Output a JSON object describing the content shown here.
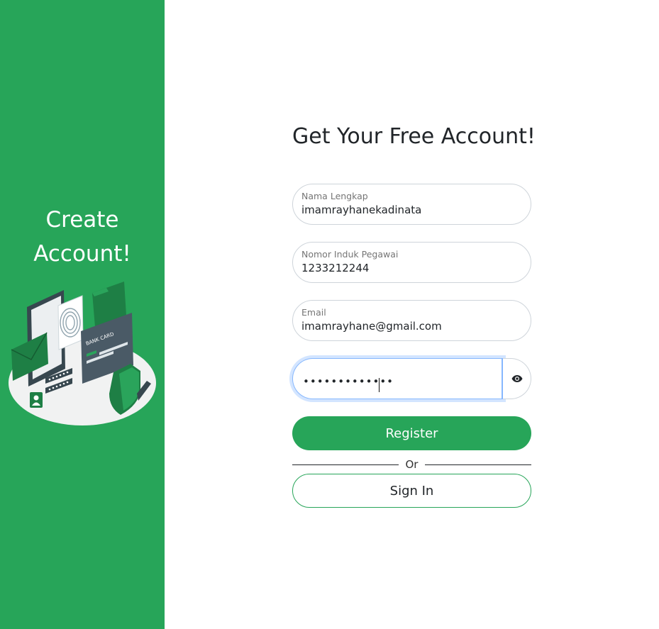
{
  "sidebar": {
    "title_line1": "Create",
    "title_line2": "Account!",
    "illustration_card_text": "BANK CARD"
  },
  "form": {
    "heading": "Get Your Free Account!",
    "full_name": {
      "label": "Nama Lengkap",
      "value": "imamrayhanekadinata"
    },
    "employee_id": {
      "label": "Nomor Induk Pegawai",
      "value": "1233212244"
    },
    "email": {
      "label": "Email",
      "value": "imamrayhane@gmail.com"
    },
    "password": {
      "masked_value": "•••••••••••••"
    },
    "register_label": "Register",
    "divider_label": "Or",
    "signin_label": "Sign In"
  },
  "colors": {
    "brand_green": "#27a559",
    "focus_blue": "#86b7fe"
  },
  "icons": {
    "password_toggle": "eye-icon"
  }
}
